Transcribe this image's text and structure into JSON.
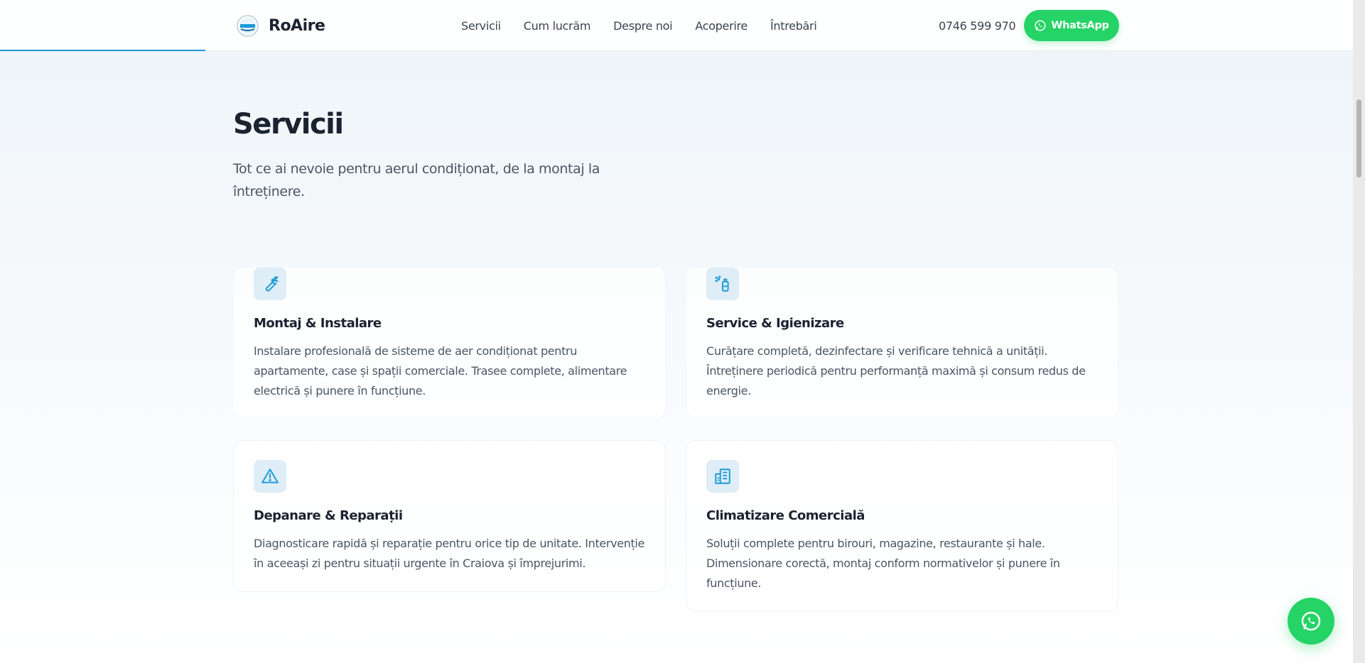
{
  "header": {
    "brand": "RoAire",
    "nav": [
      "Servicii",
      "Cum lucrăm",
      "Despre noi",
      "Acoperire",
      "Întrebări"
    ],
    "phone": "0746 599 970",
    "whatsapp_label": "WhatsApp"
  },
  "services": {
    "title": "Servicii",
    "subtitle": "Tot ce ai nevoie pentru aerul condiționat, de la montaj la întreținere.",
    "cards": [
      {
        "icon": "wrench-icon",
        "title": "Montaj & Instalare",
        "description": "Instalare profesională de sisteme de aer condiționat pentru apartamente, case și spații comerciale. Trasee complete, alimentare electrică și punere în funcțiune."
      },
      {
        "icon": "spray-bottle-icon",
        "title": "Service & Igienizare",
        "description": "Curățare completă, dezinfectare și verificare tehnică a unității. Întreținere periodică pentru performanță maximă și consum redus de energie."
      },
      {
        "icon": "warning-triangle-icon",
        "title": "Depanare & Reparații",
        "description": "Diagnosticare rapidă și reparație pentru orice tip de unitate. Intervenție în aceeași zi pentru situații urgente în Craiova și împrejurimi."
      },
      {
        "icon": "building-icon",
        "title": "Climatizare Comercială",
        "description": "Soluții complete pentru birouri, magazine, restaurante și hale. Dimensionare corectă, montaj conform normativelor și punere în funcțiune."
      }
    ]
  },
  "colors": {
    "accent": "#1a9bd7",
    "whatsapp_green": "#25d366",
    "icon_bg": "#deedf6",
    "text_dark": "#1b2230",
    "text_muted": "#4b5563"
  }
}
